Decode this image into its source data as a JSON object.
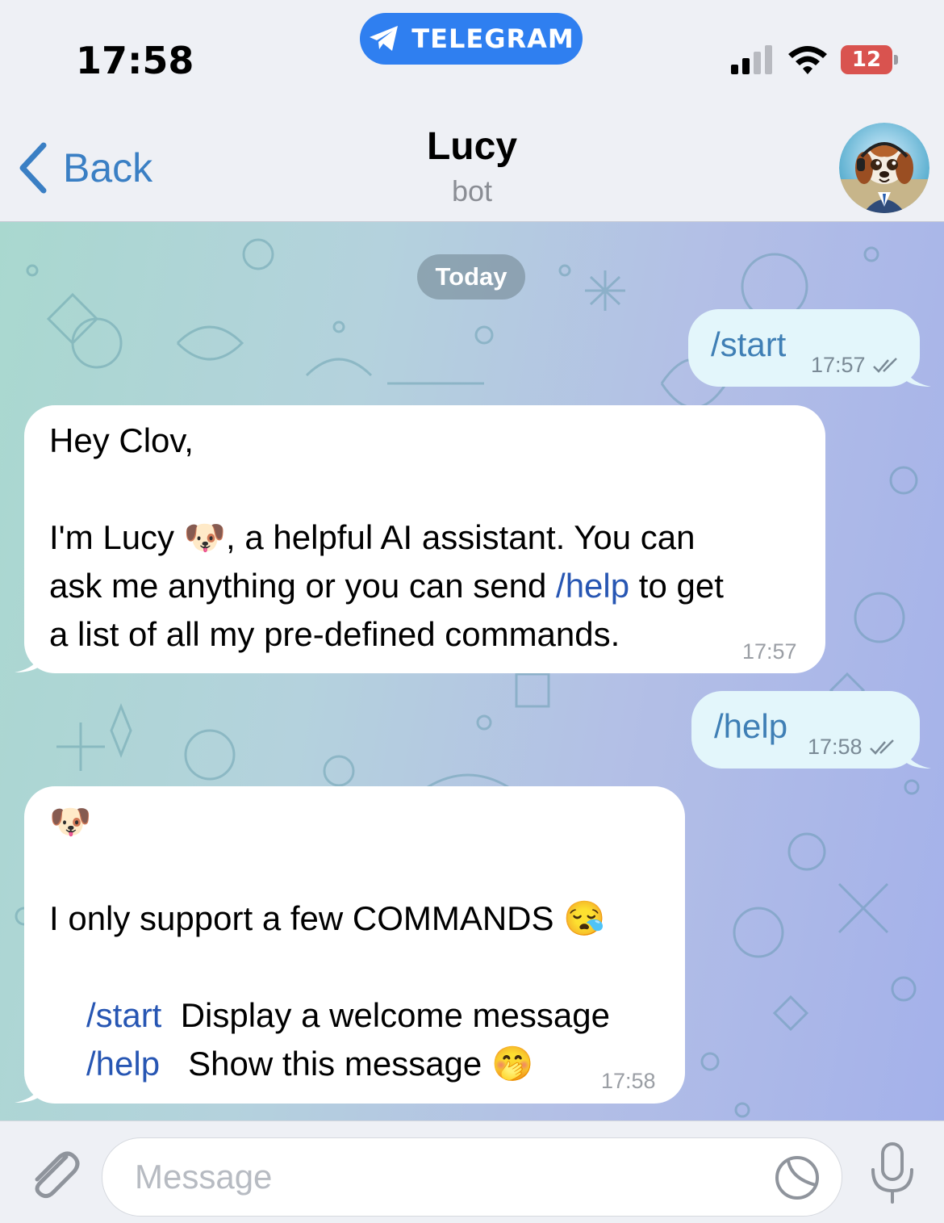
{
  "status_bar": {
    "time": "17:58",
    "pill_label": "TELEGRAM",
    "battery": "12"
  },
  "header": {
    "back_label": "Back",
    "title": "Lucy",
    "subtitle": "bot"
  },
  "chat": {
    "date_label": "Today",
    "messages": [
      {
        "direction": "out",
        "text": "/start",
        "time": "17:57"
      },
      {
        "direction": "in",
        "greeting": "Hey Clov,",
        "line1a": "I'm Lucy ",
        "emoji": "🐶",
        "line1b": ", a helpful AI assistant. You can",
        "line2a": "ask me anything or you can send ",
        "line2_cmd": "/help",
        "line2b": " to get",
        "line3": "a list of all my pre-defined commands.",
        "time": "17:57"
      },
      {
        "direction": "out",
        "text": "/help",
        "time": "17:58"
      },
      {
        "direction": "in",
        "emoji": "🐶",
        "intro": "I only support a few COMMANDS ",
        "intro_emoji": "😪",
        "commands": [
          {
            "cmd": "/start",
            "desc": "Display a welcome message"
          },
          {
            "cmd": "/help",
            "desc": "Show this message ",
            "emoji": "🤭"
          }
        ],
        "time": "17:58"
      }
    ]
  },
  "composer": {
    "placeholder": "Message"
  },
  "colors": {
    "accent": "#2f7ff0",
    "link": "#2756b3",
    "outgoing_bubble": "#e3f6fb",
    "battery": "#d9534f"
  },
  "icons": [
    "telegram-icon",
    "signal-icon",
    "wifi-icon",
    "battery-icon",
    "back-chevron-icon",
    "avatar",
    "paperclip-icon",
    "sticker-icon",
    "mic-icon",
    "double-check-icon"
  ]
}
